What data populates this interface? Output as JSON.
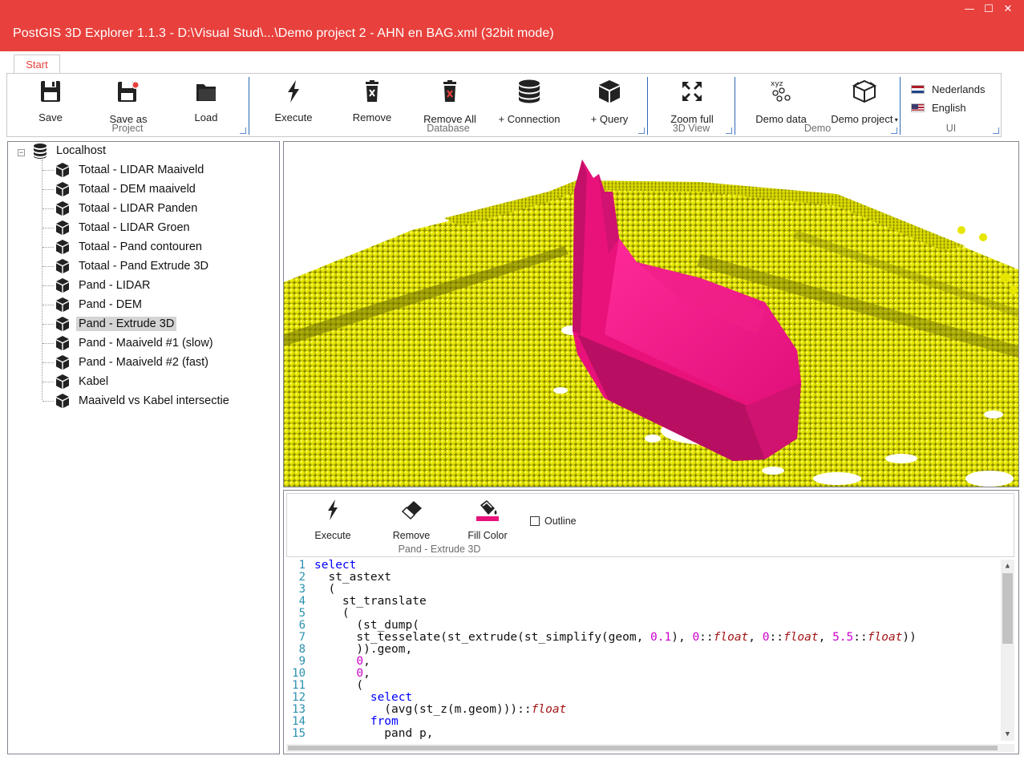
{
  "window": {
    "title": "PostGIS 3D Explorer 1.1.3 - D:\\Visual Stud\\...\\Demo project 2 - AHN en BAG.xml (32bit mode)",
    "minimize": "—",
    "maximize": "☐",
    "close": "✕"
  },
  "ribbon": {
    "tabs": [
      {
        "label": "Start"
      }
    ],
    "groups": {
      "project": "Project",
      "database": "Database",
      "view3d": "3D View",
      "demo": "Demo",
      "ui": "UI"
    },
    "buttons": {
      "save": "Save",
      "save_as": "Save as",
      "load": "Load",
      "execute": "Execute",
      "remove": "Remove",
      "remove_all": "Remove All",
      "add_connection": "+ Connection",
      "add_query": "+ Query",
      "zoom_full": "Zoom full",
      "demo_data": "Demo data",
      "demo_project": "Demo project"
    },
    "demo_data_icon_text": "xyz",
    "languages": [
      "Nederlands",
      "English"
    ]
  },
  "tree": {
    "root": "Localhost",
    "items": [
      "Totaal - LIDAR Maaiveld",
      "Totaal - DEM maaiveld",
      "Totaal - LIDAR Panden",
      "Totaal - LIDAR Groen",
      "Totaal - Pand contouren",
      "Totaal - Pand Extrude 3D",
      "Pand - LIDAR",
      "Pand - DEM",
      "Pand - Extrude 3D",
      "Pand - Maaiveld #1 (slow)",
      "Pand - Maaiveld #2 (fast)",
      "Kabel",
      "Maaiveld vs Kabel intersectie"
    ],
    "selected_index": 8
  },
  "query_panel": {
    "execute": "Execute",
    "remove": "Remove",
    "fill_color": "Fill Color",
    "outline": "Outline",
    "group_label": "Pand - Extrude 3D",
    "fill_color_value": "#e8127a"
  },
  "colors": {
    "accent": "#e8403c",
    "points": "#e6e600",
    "extrude": "#e8127a"
  },
  "editor": {
    "line_numbers": [
      "1",
      "2",
      "3",
      "4",
      "5",
      "6",
      "7",
      "8",
      "9",
      "10",
      "11",
      "12",
      "13",
      "14",
      "15"
    ]
  }
}
